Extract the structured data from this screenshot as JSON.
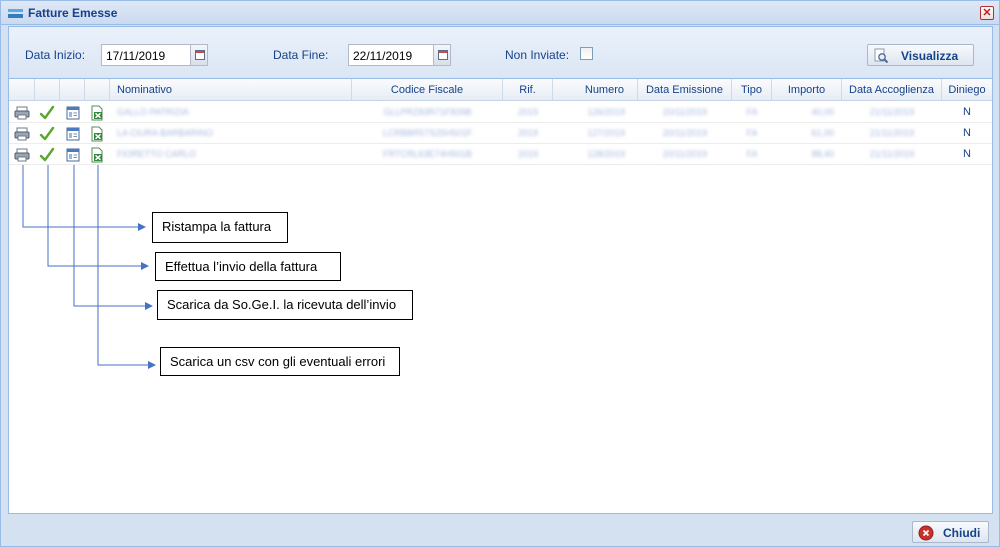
{
  "window": {
    "title": "Fatture Emesse",
    "close_glyph": "✕"
  },
  "filters": {
    "start_label": "Data Inizio:",
    "start_value": "17/11/2019",
    "end_label": "Data Fine:",
    "end_value": "22/11/2019",
    "non_inviate_label": "Non Inviate:",
    "non_inviate_checked": false,
    "show_button": "Visualizza"
  },
  "table": {
    "columns": [
      "Nominativo",
      "Codice Fiscale",
      "Rif.",
      "Numero",
      "Data Emissione",
      "Tipo",
      "Importo",
      "Data Accoglienza",
      "Diniego"
    ],
    "action_icons": [
      "printer-icon",
      "checkmark-icon",
      "receipt-window-icon",
      "excel-csv-icon"
    ],
    "rows": [
      {
        "nominativo": "GALLO PATRIZIA",
        "codice_fiscale": "GLLPRZ83R71F839B",
        "rif": "2019",
        "numero": "126/2019",
        "data_emissione": "20/11/2019",
        "tipo": "FA",
        "importo": "40,00",
        "data_accoglienza": "21/11/2019",
        "diniego": "N"
      },
      {
        "nominativo": "LA CIURA BARBARINO",
        "codice_fiscale": "LCRBBR57S25H501F",
        "rif": "2019",
        "numero": "127/2019",
        "data_emissione": "20/11/2019",
        "tipo": "FA",
        "importo": "61,00",
        "data_accoglienza": "21/11/2019",
        "diniego": "N"
      },
      {
        "nominativo": "FIORETTO CARLO",
        "codice_fiscale": "FRTCRL63E74H501B",
        "rif": "2019",
        "numero": "128/2019",
        "data_emissione": "20/11/2019",
        "tipo": "FA",
        "importo": "88,40",
        "data_accoglienza": "21/11/2019",
        "diniego": "N"
      }
    ]
  },
  "annotations": {
    "reprint": "Ristampa la fattura",
    "send": "Effettua l’invio della fattura",
    "receipt": "Scarica da So.Ge.I. la ricevuta dell’invio",
    "csv": "Scarica un csv con gli eventuali errori",
    "arrow_color": "#4472c4"
  },
  "footer": {
    "close_button": "Chiudi"
  },
  "colors": {
    "header_text": "#15428b",
    "border": "#99bbe8",
    "panel_bg": "#d3e1f1"
  }
}
